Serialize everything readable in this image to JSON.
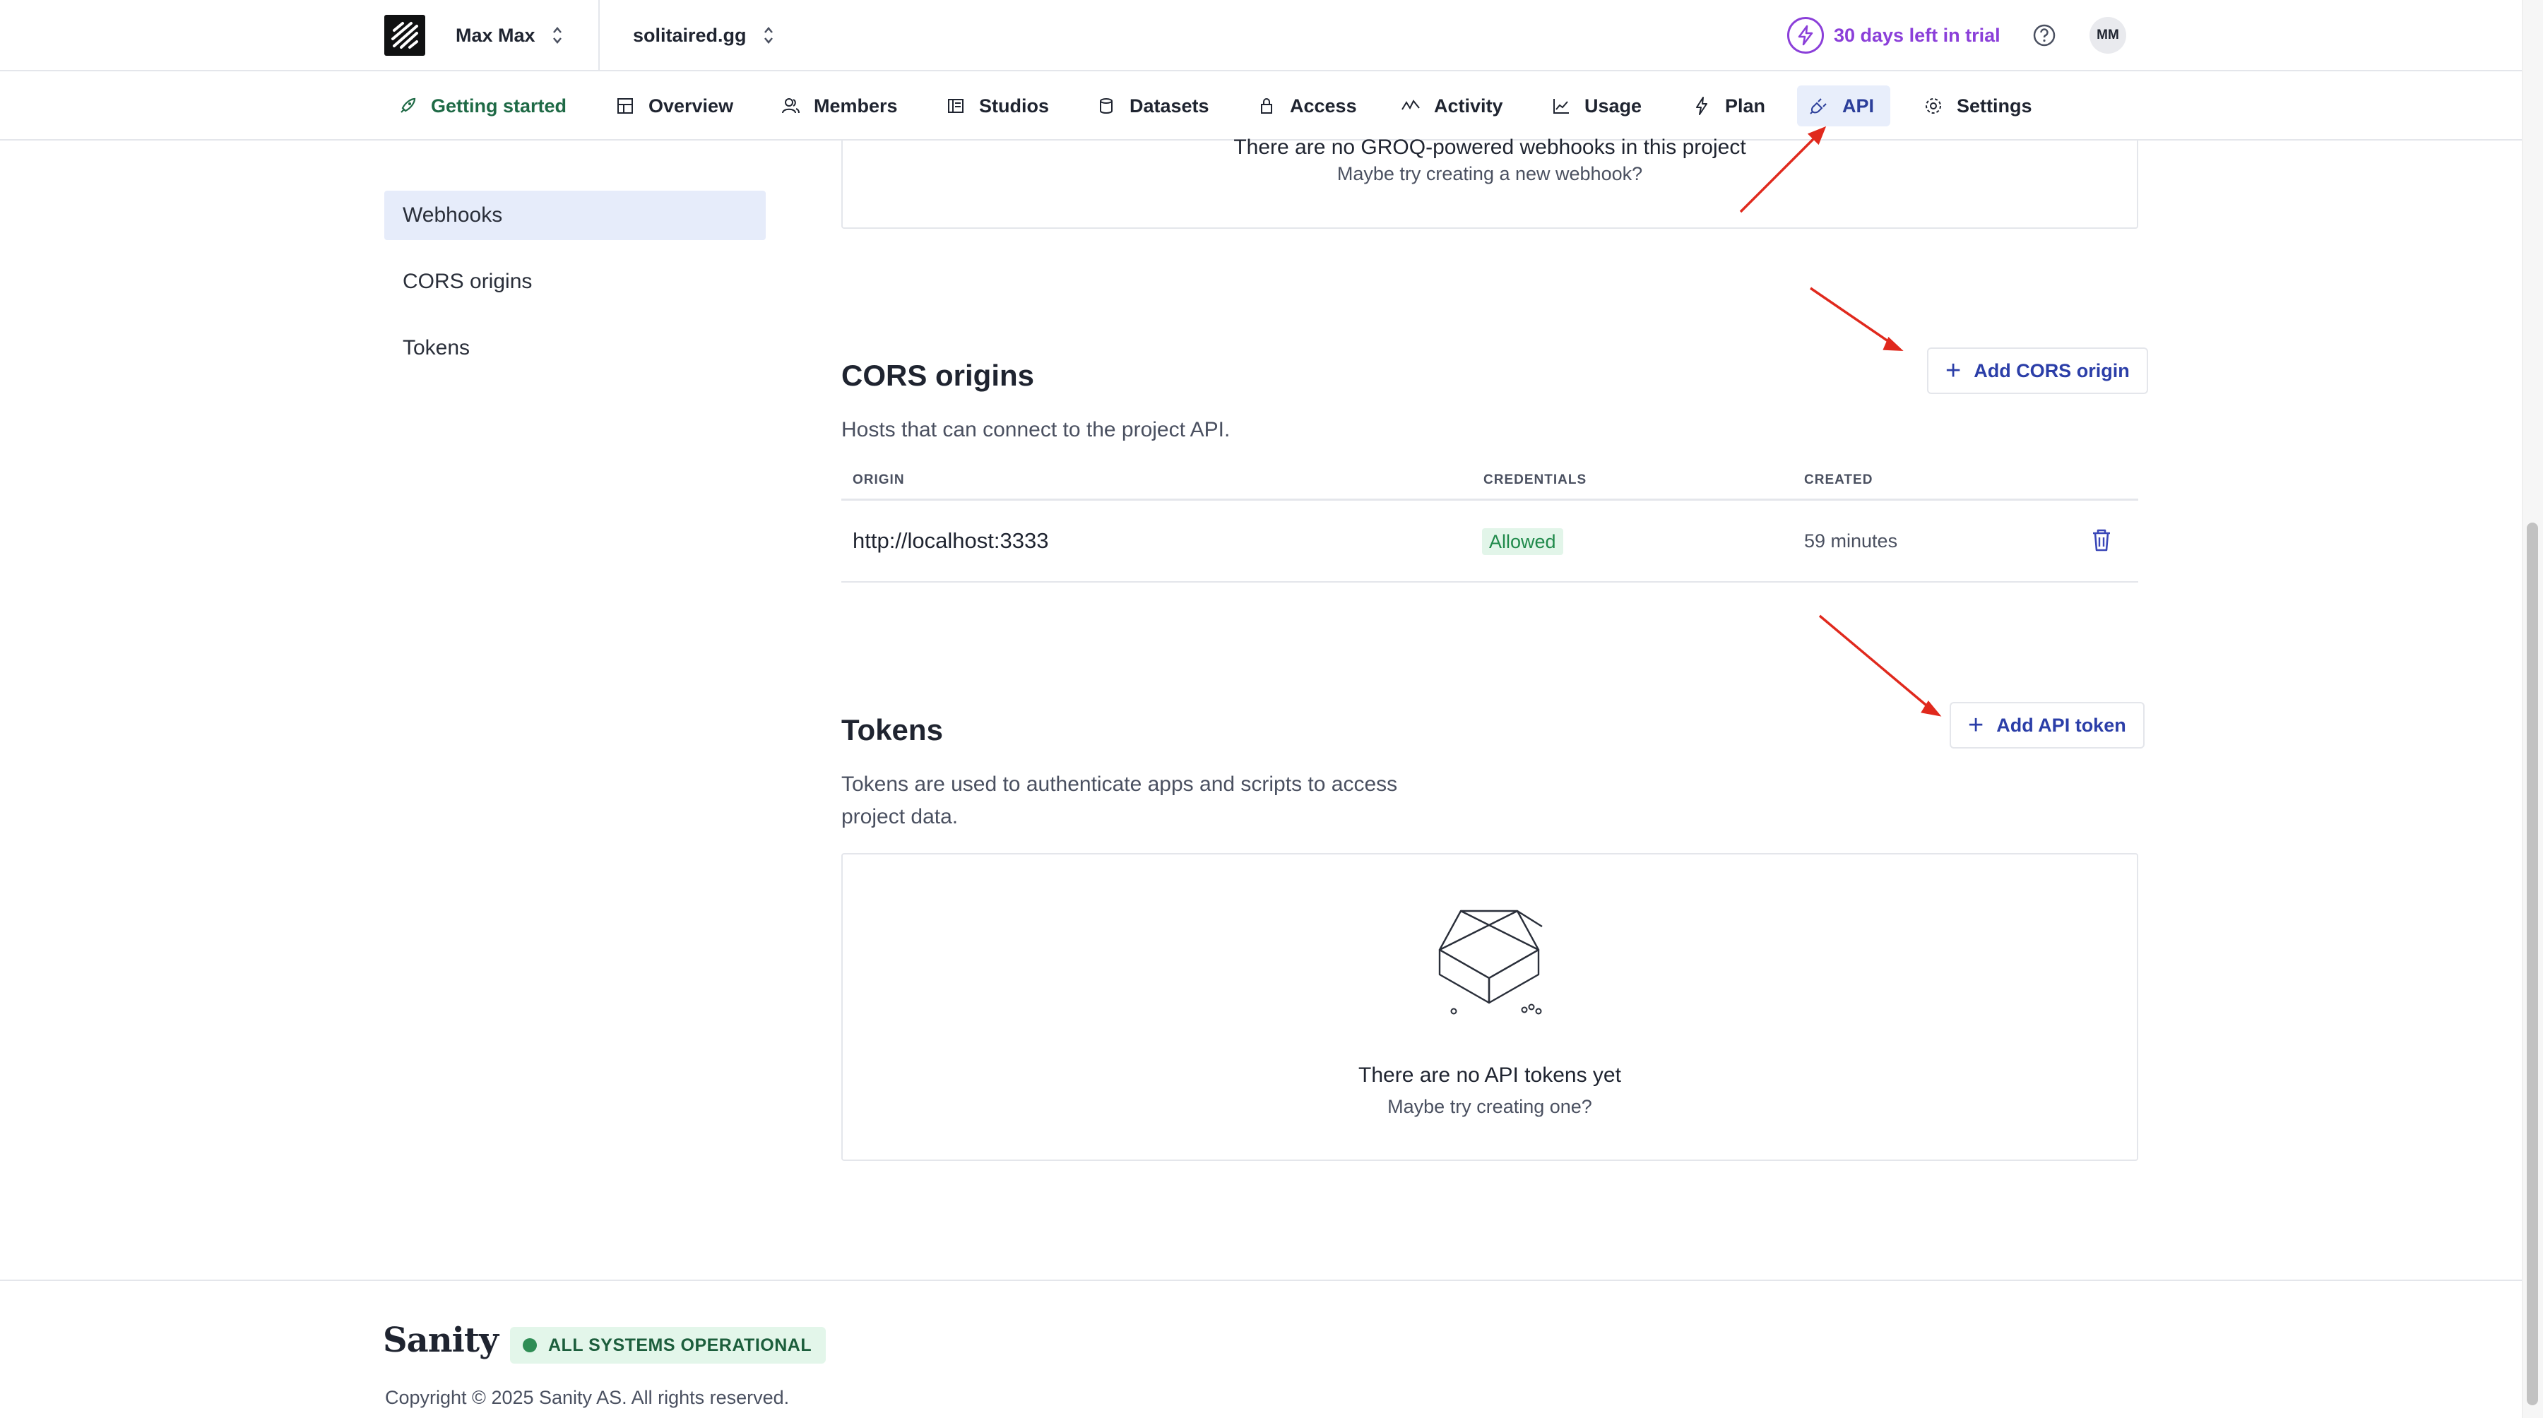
{
  "header": {
    "org_name": "Max Max",
    "project_name": "solitaired.gg",
    "trial_text": "30 days left in trial",
    "avatar_initials": "MM"
  },
  "tabs": [
    {
      "label": "Getting started",
      "icon": "rocket-icon"
    },
    {
      "label": "Overview",
      "icon": "layout-icon"
    },
    {
      "label": "Members",
      "icon": "users-icon"
    },
    {
      "label": "Studios",
      "icon": "studio-icon"
    },
    {
      "label": "Datasets",
      "icon": "database-icon"
    },
    {
      "label": "Access",
      "icon": "lock-icon"
    },
    {
      "label": "Activity",
      "icon": "activity-icon"
    },
    {
      "label": "Usage",
      "icon": "chart-icon"
    },
    {
      "label": "Plan",
      "icon": "bolt-icon"
    },
    {
      "label": "API",
      "icon": "plug-icon",
      "active": true
    },
    {
      "label": "Settings",
      "icon": "gear-icon"
    }
  ],
  "sidebar": {
    "items": [
      {
        "label": "Webhooks",
        "active": true
      },
      {
        "label": "CORS origins"
      },
      {
        "label": "Tokens"
      }
    ]
  },
  "webhooks": {
    "empty_title": "There are no GROQ-powered webhooks in this project",
    "empty_sub": "Maybe try creating a new webhook?"
  },
  "cors": {
    "title": "CORS origins",
    "description": "Hosts that can connect to the project API.",
    "add_label": "Add CORS origin",
    "columns": [
      "ORIGIN",
      "CREDENTIALS",
      "CREATED"
    ],
    "rows": [
      {
        "origin": "http://localhost:3333",
        "credentials": "Allowed",
        "created": "59 minutes"
      }
    ]
  },
  "tokens": {
    "title": "Tokens",
    "description_line1": "Tokens are used to authenticate apps and scripts to access",
    "description_line2": "project data.",
    "add_label": "Add API token",
    "empty_title": "There are no API tokens yet",
    "empty_sub": "Maybe try creating one?"
  },
  "footer": {
    "brand": "Sanity",
    "status": "ALL SYSTEMS OPERATIONAL",
    "copyright": "Copyright © 2025 Sanity AS. All rights reserved."
  },
  "colors": {
    "accent": "#2b3ea8",
    "trial": "#8b3fd9",
    "success": "#208a4b",
    "annotation_arrow": "#e0291d"
  }
}
